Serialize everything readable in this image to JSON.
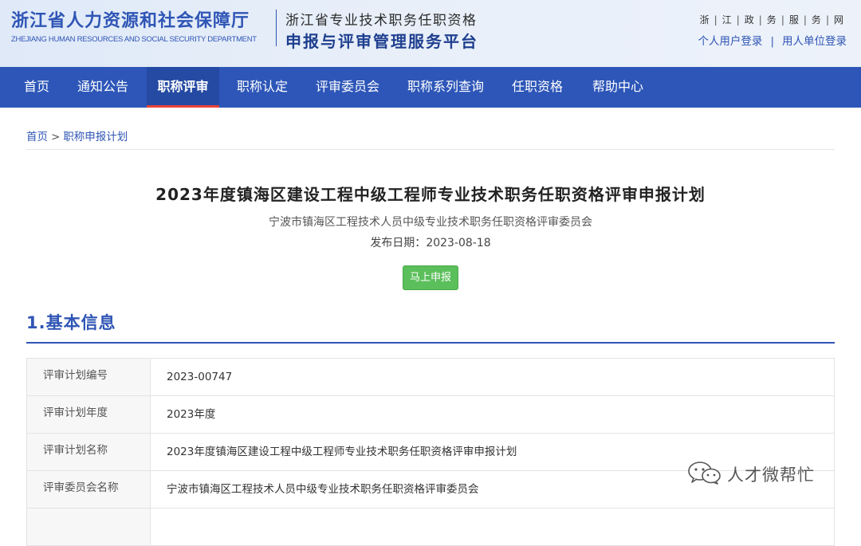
{
  "header": {
    "department_cn": "浙江省人力资源和社会保障厅",
    "department_en": "ZHEJIANG HUMAN RESOURCES AND SOCIAL SECURITY DEPARTMENT",
    "platform_line1": "浙江省专业技术职务任职资格",
    "platform_line2": "申报与评审管理服务平台",
    "portal_chars": [
      "浙",
      "江",
      "政",
      "务",
      "服",
      "务",
      "网"
    ],
    "personal_login": "个人用户登录",
    "separator": "|",
    "employer_login": "用人单位登录"
  },
  "nav": {
    "items": [
      {
        "label": "首页"
      },
      {
        "label": "通知公告"
      },
      {
        "label": "职称评审"
      },
      {
        "label": "职称认定"
      },
      {
        "label": "评审委员会"
      },
      {
        "label": "职称系列查询"
      },
      {
        "label": "任职资格"
      },
      {
        "label": "帮助中心"
      }
    ],
    "active_index": 2
  },
  "breadcrumb": {
    "home": "首页",
    "separator": ">",
    "current": "职称申报计划"
  },
  "plan": {
    "title": "2023年度镇海区建设工程中级工程师专业技术职务任职资格评审申报计划",
    "committee": "宁波市镇海区工程技术人员中级专业技术职务任职资格评审委员会",
    "publish_date_label": "发布日期：",
    "publish_date": "2023-08-18",
    "apply_button": "马上申报"
  },
  "section": {
    "title": "1.基本信息"
  },
  "info_rows": [
    {
      "label": "评审计划编号",
      "value": "2023-00747"
    },
    {
      "label": "评审计划年度",
      "value": "2023年度"
    },
    {
      "label": "评审计划名称",
      "value": "2023年度镇海区建设工程中级工程师专业技术职务任职资格评审申报计划"
    },
    {
      "label": "评审委员会名称",
      "value": "宁波市镇海区工程技术人员中级专业技术职务任职资格评审委员会"
    },
    {
      "label": "",
      "value": ""
    }
  ],
  "watermark": {
    "text": "人才微帮忙",
    "icon": "wechat-icon"
  },
  "colors": {
    "brand_blue": "#2d56b8",
    "nav_active_underline": "#e8443a",
    "apply_green": "#5bbf5b"
  }
}
